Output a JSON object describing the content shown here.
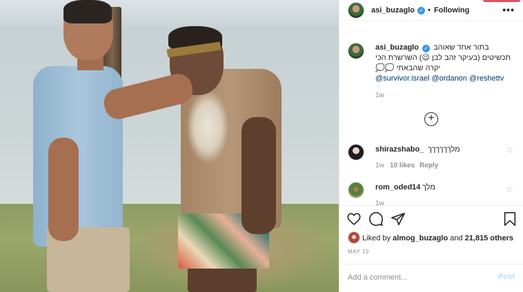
{
  "post": {
    "image_alt": "Two men standing on a beach"
  },
  "header": {
    "username": "asi_buzaglo",
    "separator": "•",
    "follow_status": "Following",
    "more_icon": "more-horizontal-icon"
  },
  "caption": {
    "username": "asi_buzaglo",
    "line1": "בתור אחד שאוהב",
    "line2": "תכשיטים (בעיקר זהב לבן 😉) השרשרת הכי",
    "line3": "יקרה שהבאתי 💭💭",
    "mentions": "@survivor.israel @ordanon @reshettv",
    "time": "1w"
  },
  "load_more_icon": "plus-circle-icon",
  "comments": [
    {
      "username": "shirazshabo_",
      "text": "מלךךךךךך",
      "time": "1w",
      "likes": "10 likes",
      "reply": "Reply"
    },
    {
      "username": "rom_oded14",
      "text": "מלך",
      "time": "1w"
    }
  ],
  "actions": {
    "like_icon": "heart-icon",
    "comment_icon": "comment-icon",
    "share_icon": "send-icon",
    "save_icon": "bookmark-icon"
  },
  "likes": {
    "prefix": "Liked by",
    "user": "almog_buzaglo",
    "and": "and",
    "others": "21,815 others"
  },
  "date": "MAY 19",
  "add_comment": {
    "placeholder": "Add a comment...",
    "post_label": "Post"
  },
  "colors": {
    "verified": "#3897f0",
    "link": "#00376b",
    "post_disabled": "#b2dffc",
    "muted": "#8e8e8e"
  }
}
